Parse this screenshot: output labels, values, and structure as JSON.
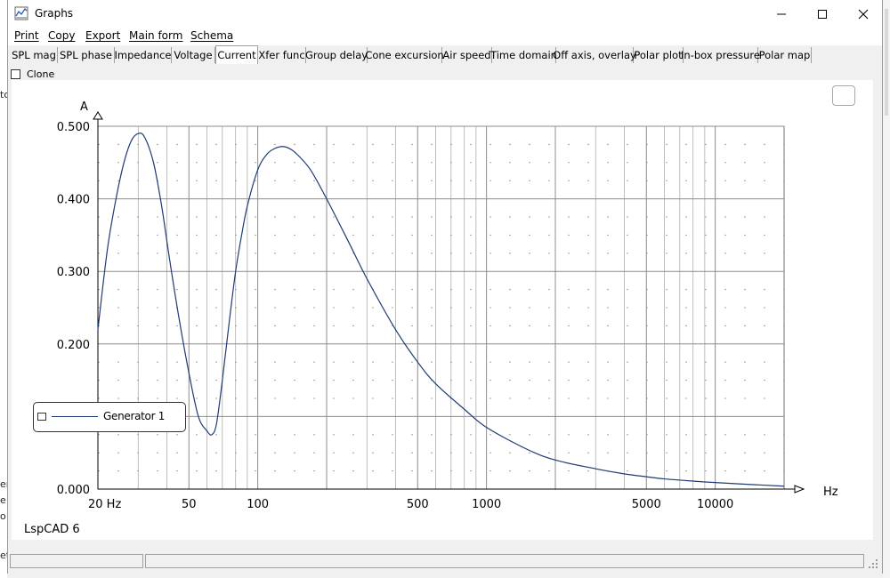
{
  "window": {
    "title": "Graphs"
  },
  "menu": [
    {
      "label": "Print"
    },
    {
      "label": "Copy"
    },
    {
      "label": "Export"
    },
    {
      "label": "Main form"
    },
    {
      "label": "Schema"
    }
  ],
  "tabs": [
    {
      "label": "SPL mag"
    },
    {
      "label": "SPL phase"
    },
    {
      "label": "Impedance"
    },
    {
      "label": "Voltage"
    },
    {
      "label": "Current",
      "active": true
    },
    {
      "label": "Xfer func"
    },
    {
      "label": "Group delay"
    },
    {
      "label": "Cone excursion"
    },
    {
      "label": "Air speed"
    },
    {
      "label": "Time domain"
    },
    {
      "label": "Off axis, overlay"
    },
    {
      "label": "Polar plot"
    },
    {
      "label": "In-box pressure"
    },
    {
      "label": "Polar map"
    }
  ],
  "options": {
    "clone_label": "Clone",
    "clone_checked": false
  },
  "brand": "LspCAD 6",
  "colors": {
    "curve": "#1f3a73",
    "grid": "#8c8c8c",
    "background": "#ffffff"
  },
  "chart_data": {
    "type": "line",
    "ylabel": "A",
    "xlabel": "Hz",
    "x_scale": "log",
    "xlim": [
      20,
      20000
    ],
    "ylim": [
      0,
      0.5
    ],
    "x_ticks": [
      {
        "value": 20,
        "label": "20 Hz"
      },
      {
        "value": 50,
        "label": "50"
      },
      {
        "value": 100,
        "label": "100"
      },
      {
        "value": 500,
        "label": "500"
      },
      {
        "value": 1000,
        "label": "1000"
      },
      {
        "value": 5000,
        "label": "5000"
      },
      {
        "value": 10000,
        "label": "10000"
      }
    ],
    "y_ticks": [
      {
        "value": 0,
        "label": "0.000"
      },
      {
        "value": 0.1,
        "label": ""
      },
      {
        "value": 0.2,
        "label": "0.200"
      },
      {
        "value": 0.3,
        "label": "0.300"
      },
      {
        "value": 0.4,
        "label": "0.400"
      },
      {
        "value": 0.5,
        "label": "0.500"
      }
    ],
    "grid": true,
    "legend_position": "left",
    "series": [
      {
        "name": "Generator 1",
        "x": [
          20,
          22,
          24,
          26,
          28,
          30,
          32,
          35,
          38,
          41,
          45,
          50,
          55,
          60,
          63,
          66,
          70,
          75,
          80,
          85,
          90,
          100,
          110,
          120,
          130,
          140,
          150,
          170,
          200,
          250,
          300,
          400,
          500,
          600,
          800,
          1000,
          1500,
          2000,
          3000,
          4000,
          5000,
          6000,
          8000,
          10000,
          15000,
          20000
        ],
        "y": [
          0.22,
          0.33,
          0.4,
          0.45,
          0.48,
          0.49,
          0.485,
          0.45,
          0.39,
          0.32,
          0.24,
          0.16,
          0.1,
          0.08,
          0.075,
          0.09,
          0.15,
          0.23,
          0.3,
          0.35,
          0.39,
          0.44,
          0.462,
          0.47,
          0.472,
          0.468,
          0.46,
          0.44,
          0.4,
          0.34,
          0.29,
          0.22,
          0.175,
          0.145,
          0.11,
          0.085,
          0.055,
          0.04,
          0.028,
          0.021,
          0.017,
          0.014,
          0.011,
          0.009,
          0.006,
          0.004
        ]
      }
    ]
  }
}
